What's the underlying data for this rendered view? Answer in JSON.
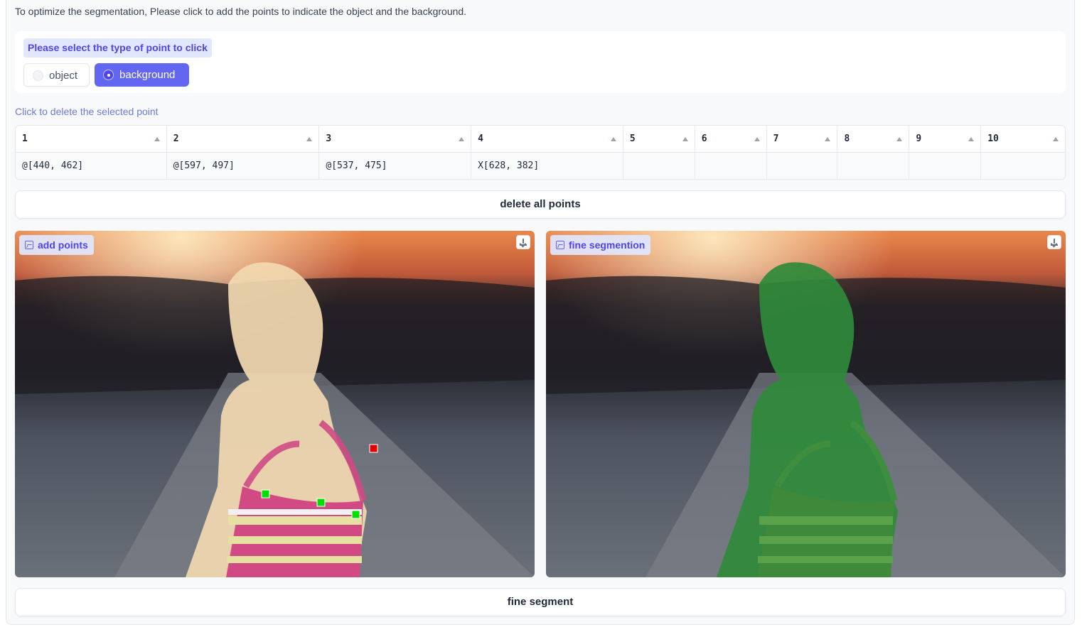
{
  "instruction": "To optimize the segmentation, Please click to add the points to indicate the object and the background.",
  "point_type": {
    "label": "Please select the type of point to click",
    "options": [
      "object",
      "background"
    ],
    "selected": "background"
  },
  "points_table": {
    "label": "Click to delete the selected point",
    "headers": [
      "1",
      "2",
      "3",
      "4",
      "5",
      "6",
      "7",
      "8",
      "9",
      "10"
    ],
    "row": [
      "@[440, 462]",
      "@[597, 497]",
      "@[537, 475]",
      "X[628, 382]",
      "",
      "",
      "",
      "",
      "",
      ""
    ]
  },
  "delete_all_label": "delete all points",
  "left_image": {
    "label": "add points"
  },
  "right_image": {
    "label": "fine segmention"
  },
  "fine_segment_label": "fine segment",
  "colors": {
    "accent": "#6366f1",
    "object_point": "#00e000",
    "background_point": "#e00000",
    "mask_left": "#f2d9b0",
    "mask_right": "#2f8a3a"
  }
}
